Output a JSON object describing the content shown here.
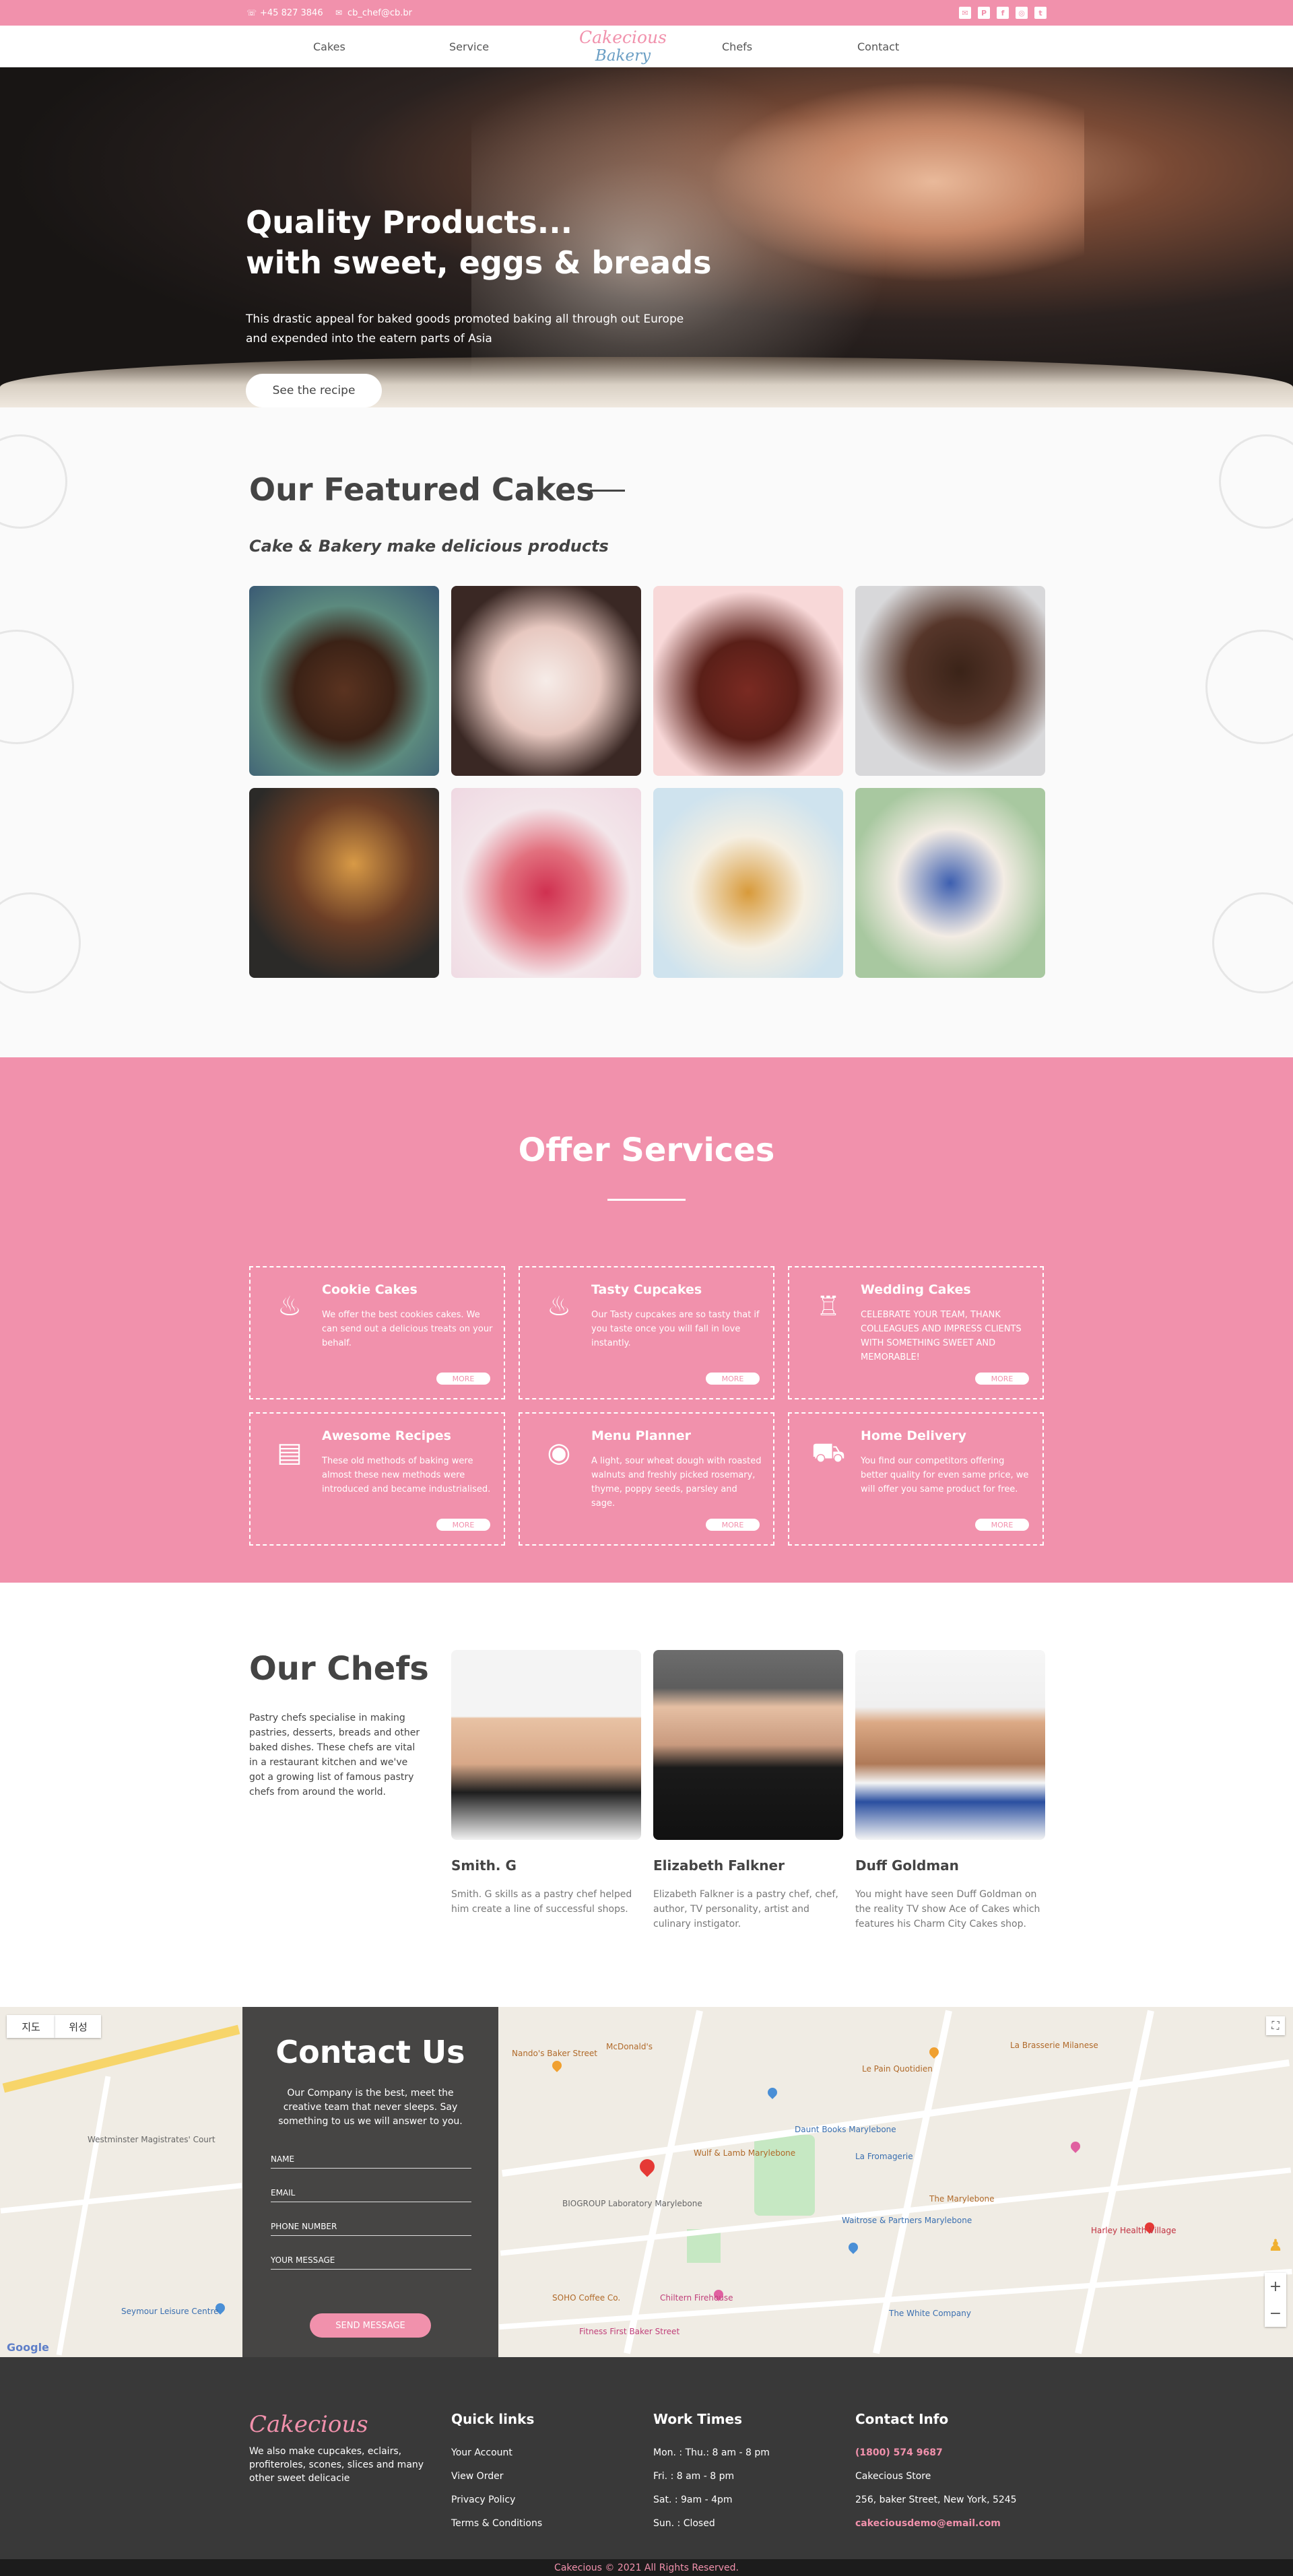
{
  "topbar": {
    "phone": "+45 827 3846",
    "email": "cb_chef@cb.br",
    "socials": [
      "email-icon",
      "pinterest-icon",
      "facebook-icon",
      "instagram-icon",
      "twitter-icon"
    ]
  },
  "nav": {
    "items": [
      "Cakes",
      "Service",
      "Chefs",
      "Contact"
    ],
    "logo_top": "Cakecious",
    "logo_bottom": "Bakery"
  },
  "hero": {
    "title_line1": "Quality Products...",
    "title_line2": "with sweet, eggs & breads",
    "description": "This drastic appeal for baked goods promoted baking all through out Europe and expended into the eatern parts of Asia",
    "button": "See the recipe"
  },
  "featured": {
    "title": "Our Featured Cakes",
    "subtitle": "Cake & Bakery make delicious products"
  },
  "services": {
    "title": "Offer Services",
    "more_label": "MORE",
    "items": [
      {
        "title": "Cookie Cakes",
        "description": "We offer the best cookies cakes. We can send out a delicious treats on your behalf.",
        "icon": "cupcake-icon"
      },
      {
        "title": "Tasty Cupcakes",
        "description": "Our Tasty cupcakes are so tasty that if you taste once you will fall in love instantly.",
        "icon": "cupcake-icon"
      },
      {
        "title": "Wedding Cakes",
        "description": "CELEBRATE YOUR TEAM, THANK COLLEAGUES AND IMPRESS CLIENTS WITH SOMETHING SWEET AND MEMORABLE!",
        "icon": "wedding-cake-icon"
      },
      {
        "title": "Awesome Recipes",
        "description": "These old methods of baking were almost these new methods were introduced and became industrialised.",
        "icon": "recipe-book-icon"
      },
      {
        "title": "Menu Planner",
        "description": "A light, sour wheat dough with roasted walnuts and freshly picked rosemary, thyme, poppy seeds, parsley and sage.",
        "icon": "cookie-icon"
      },
      {
        "title": "Home Delivery",
        "description": "You find our competitors offering better quality for even same price, we will offer you same product for free.",
        "icon": "delivery-truck-icon"
      }
    ]
  },
  "chefs": {
    "title": "Our Chefs",
    "intro": "Pastry chefs specialise in making pastries, desserts, breads and other baked dishes. These chefs are vital in a restaurant kitchen and we've got a growing list of famous pastry chefs from around the world.",
    "items": [
      {
        "name": "Smith. G",
        "description": "Smith. G skills as a pastry chef helped him create a line of successful shops."
      },
      {
        "name": "Elizabeth Falkner",
        "description": "Elizabeth Falkner is a pastry chef, chef, author, TV personality, artist and culinary instigator."
      },
      {
        "name": "Duff Goldman",
        "description": "You might have seen Duff Goldman on the reality TV show Ace of Cakes which features his Charm City Cakes shop."
      }
    ]
  },
  "map": {
    "tab_map": "지도",
    "tab_satellite": "위성",
    "labels": [
      "Nando's Baker Street",
      "McDonald's",
      "Daunt Books Marylebone",
      "Wulf & Lamb Marylebone",
      "La Fromagerie",
      "The Marylebone",
      "SOHO Coffee Co.",
      "Chiltern Firehouse",
      "Fitness First Baker Street",
      "Waitrose & Partners Marylebone",
      "Le Pain Quotidien",
      "The White Company",
      "La Brasserie Milanese",
      "Harley Health Village",
      "Seymour Leisure Centre",
      "Westminster Magistrates' Court",
      "BIOGROUP Laboratory Marylebone"
    ],
    "google": "Google"
  },
  "contact": {
    "title": "Contact Us",
    "description": "Our Company is the best, meet the creative team that never sleeps. Say something to us we will answer to you.",
    "fields": [
      "NAME",
      "EMAIL",
      "PHONE NUMBER",
      "YOUR MESSAGE"
    ],
    "button": "SEND MESSAGE"
  },
  "footer": {
    "logo": "Cakecious",
    "about": "We also make cupcakes, eclairs, profiteroles, scones, slices and many other sweet delicacie",
    "quick_title": "Quick links",
    "quick_links": [
      "Your Account",
      "View Order",
      "Privacy Policy",
      "Terms & Conditions"
    ],
    "work_title": "Work Times",
    "work_times": [
      "Mon. : Thu.: 8 am - 8 pm",
      "Fri. : 8 am - 8 pm",
      "Sat. : 9am - 4pm",
      "Sun. : Closed"
    ],
    "contact_title": "Contact Info",
    "phone": "(1800) 574 9687",
    "store": "Cakecious Store",
    "address": "256, baker Street, New York, 5245",
    "email": "cakeciousdemo@email.com",
    "copyright": "Cakecious © 2021 All Rights Reserved."
  },
  "colors": {
    "accent": "#f191ac",
    "dark": "#393939",
    "text": "#444444"
  }
}
